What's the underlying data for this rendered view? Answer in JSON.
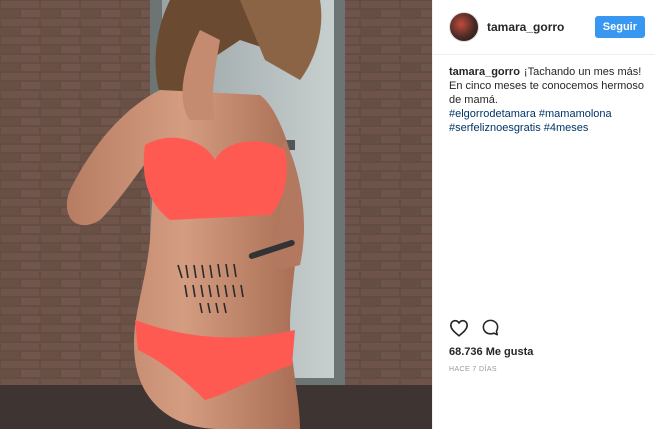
{
  "post": {
    "username": "tamara_gorro",
    "follow_label": "Seguir",
    "caption_user": "tamara_gorro",
    "caption_text": "¡Tachando un mes más! En cinco meses te conocemos hermoso de mamá.",
    "hashtags": [
      "#elgorrodetamara",
      "#mamamolona",
      "#serfeliznoesgratis",
      "#4meses"
    ],
    "likes_count": "68.736",
    "likes_label": "Me gusta",
    "timestamp": "HACE 7 DÍAS"
  },
  "icons": {
    "like": "heart-icon",
    "comment": "comment-icon"
  },
  "colors": {
    "follow_button": "#3897f0",
    "hashtag": "#003569",
    "bikini": "#ff5a52"
  }
}
